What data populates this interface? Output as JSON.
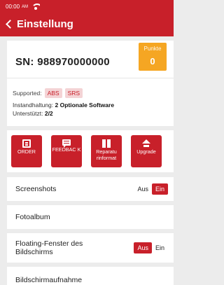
{
  "status_bar": {
    "time": "00:00",
    "ampm": "AM"
  },
  "header": {
    "title": "Einstellung"
  },
  "device": {
    "sn_label": "SN:",
    "sn_value": "988970000000",
    "points_label": "Punkte",
    "points_value": "0",
    "supported_label": "Supported:",
    "supported_tags": [
      "ABS",
      "SRS"
    ],
    "maintenance_label": "Instandhaltung:",
    "maintenance_value": "2 Optionale Software",
    "supported2_label": "Unterstützt:",
    "supported2_value": "2/2"
  },
  "actions": [
    {
      "label": "ORDER",
      "icon": "clipboard-icon"
    },
    {
      "label": "FEEDBAC K",
      "icon": "message-icon"
    },
    {
      "label": "Reparatu rinformat",
      "icon": "repair-info-icon"
    },
    {
      "label": "Upgrade",
      "icon": "upload-icon"
    }
  ],
  "settings": {
    "screenshots": {
      "label": "Screenshots",
      "off_label": "Aus",
      "on_label": "Ein",
      "selected": "Ein"
    },
    "photo_album": {
      "label": "Fotoalbum"
    },
    "floating_window": {
      "label": "Floating-Fenster des Bildschirms",
      "off_label": "Aus",
      "on_label": "Ein",
      "selected": "Aus"
    },
    "next_item": {
      "label": "Bildschirmaufnahme"
    }
  },
  "colors": {
    "accent": "#c8202a",
    "points": "#f5a623",
    "tag_bg": "#f4d3d5"
  }
}
